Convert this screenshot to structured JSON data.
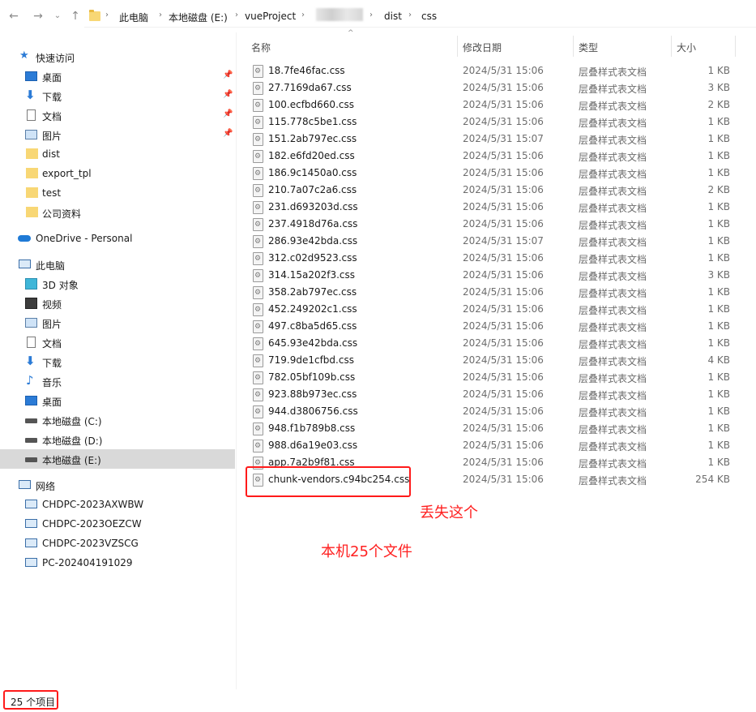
{
  "address": {
    "crumbs": [
      "此电脑",
      "本地磁盘 (E:)",
      "vueProject",
      "dist",
      "css"
    ]
  },
  "nav": {
    "quick_access": "快速访问",
    "quick_items": [
      {
        "label": "桌面",
        "icon": "desktop-icon",
        "pinned": true
      },
      {
        "label": "下载",
        "icon": "download-icon",
        "pinned": true
      },
      {
        "label": "文档",
        "icon": "document-icon",
        "pinned": true
      },
      {
        "label": "图片",
        "icon": "picture-icon",
        "pinned": true
      },
      {
        "label": "dist",
        "icon": "folder-icon"
      },
      {
        "label": "export_tpl",
        "icon": "folder-icon"
      },
      {
        "label": "test",
        "icon": "folder-icon"
      },
      {
        "label": "公司资料",
        "icon": "folder-icon"
      }
    ],
    "onedrive": "OneDrive - Personal",
    "this_pc": "此电脑",
    "pc_items": [
      {
        "label": "3D 对象",
        "icon": "3d-objects-icon"
      },
      {
        "label": "视频",
        "icon": "video-icon"
      },
      {
        "label": "图片",
        "icon": "picture-icon"
      },
      {
        "label": "文档",
        "icon": "document-icon"
      },
      {
        "label": "下载",
        "icon": "download-icon"
      },
      {
        "label": "音乐",
        "icon": "music-icon"
      },
      {
        "label": "桌面",
        "icon": "desktop-icon"
      },
      {
        "label": "本地磁盘 (C:)",
        "icon": "drive-c-icon"
      },
      {
        "label": "本地磁盘 (D:)",
        "icon": "drive-icon"
      },
      {
        "label": "本地磁盘 (E:)",
        "icon": "drive-icon",
        "selected": true
      }
    ],
    "network": "网络",
    "network_items": [
      "CHDPC-2023AXWBW",
      "CHDPC-2023OEZCW",
      "CHDPC-2023VZSCG",
      "PC-202404191029"
    ]
  },
  "columns": {
    "name": "名称",
    "date": "修改日期",
    "type": "类型",
    "size": "大小"
  },
  "files": [
    {
      "name": "18.7fe46fac.css",
      "date": "2024/5/31 15:06",
      "type": "层叠样式表文档",
      "size": "1 KB"
    },
    {
      "name": "27.7169da67.css",
      "date": "2024/5/31 15:06",
      "type": "层叠样式表文档",
      "size": "3 KB"
    },
    {
      "name": "100.ecfbd660.css",
      "date": "2024/5/31 15:06",
      "type": "层叠样式表文档",
      "size": "2 KB"
    },
    {
      "name": "115.778c5be1.css",
      "date": "2024/5/31 15:06",
      "type": "层叠样式表文档",
      "size": "1 KB"
    },
    {
      "name": "151.2ab797ec.css",
      "date": "2024/5/31 15:07",
      "type": "层叠样式表文档",
      "size": "1 KB"
    },
    {
      "name": "182.e6fd20ed.css",
      "date": "2024/5/31 15:06",
      "type": "层叠样式表文档",
      "size": "1 KB"
    },
    {
      "name": "186.9c1450a0.css",
      "date": "2024/5/31 15:06",
      "type": "层叠样式表文档",
      "size": "1 KB"
    },
    {
      "name": "210.7a07c2a6.css",
      "date": "2024/5/31 15:06",
      "type": "层叠样式表文档",
      "size": "2 KB"
    },
    {
      "name": "231.d693203d.css",
      "date": "2024/5/31 15:06",
      "type": "层叠样式表文档",
      "size": "1 KB"
    },
    {
      "name": "237.4918d76a.css",
      "date": "2024/5/31 15:06",
      "type": "层叠样式表文档",
      "size": "1 KB"
    },
    {
      "name": "286.93e42bda.css",
      "date": "2024/5/31 15:07",
      "type": "层叠样式表文档",
      "size": "1 KB"
    },
    {
      "name": "312.c02d9523.css",
      "date": "2024/5/31 15:06",
      "type": "层叠样式表文档",
      "size": "1 KB"
    },
    {
      "name": "314.15a202f3.css",
      "date": "2024/5/31 15:06",
      "type": "层叠样式表文档",
      "size": "3 KB"
    },
    {
      "name": "358.2ab797ec.css",
      "date": "2024/5/31 15:06",
      "type": "层叠样式表文档",
      "size": "1 KB"
    },
    {
      "name": "452.249202c1.css",
      "date": "2024/5/31 15:06",
      "type": "层叠样式表文档",
      "size": "1 KB"
    },
    {
      "name": "497.c8ba5d65.css",
      "date": "2024/5/31 15:06",
      "type": "层叠样式表文档",
      "size": "1 KB"
    },
    {
      "name": "645.93e42bda.css",
      "date": "2024/5/31 15:06",
      "type": "层叠样式表文档",
      "size": "1 KB"
    },
    {
      "name": "719.9de1cfbd.css",
      "date": "2024/5/31 15:06",
      "type": "层叠样式表文档",
      "size": "4 KB"
    },
    {
      "name": "782.05bf109b.css",
      "date": "2024/5/31 15:06",
      "type": "层叠样式表文档",
      "size": "1 KB"
    },
    {
      "name": "923.88b973ec.css",
      "date": "2024/5/31 15:06",
      "type": "层叠样式表文档",
      "size": "1 KB"
    },
    {
      "name": "944.d3806756.css",
      "date": "2024/5/31 15:06",
      "type": "层叠样式表文档",
      "size": "1 KB"
    },
    {
      "name": "948.f1b789b8.css",
      "date": "2024/5/31 15:06",
      "type": "层叠样式表文档",
      "size": "1 KB"
    },
    {
      "name": "988.d6a19e03.css",
      "date": "2024/5/31 15:06",
      "type": "层叠样式表文档",
      "size": "1 KB"
    },
    {
      "name": "app.7a2b9f81.css",
      "date": "2024/5/31 15:06",
      "type": "层叠样式表文档",
      "size": "1 KB"
    },
    {
      "name": "chunk-vendors.c94bc254.css",
      "date": "2024/5/31 15:06",
      "type": "层叠样式表文档",
      "size": "254 KB"
    }
  ],
  "annotations": {
    "missing": "丢失这个",
    "count": "本机25个文件"
  },
  "status": {
    "count": "25 个项目"
  },
  "colors": {
    "selection": "#cce8ff",
    "annotation_red": "#ff1a1a"
  }
}
